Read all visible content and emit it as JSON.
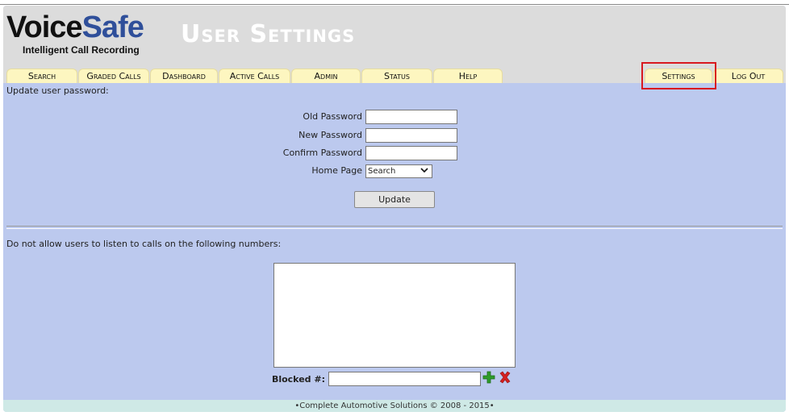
{
  "header": {
    "logo_voice": "Voice",
    "logo_safe": "Safe",
    "logo_subtitle": "Intelligent Call Recording",
    "page_title": "User Settings"
  },
  "nav": {
    "tabs": [
      {
        "label": "Search"
      },
      {
        "label": "Graded Calls"
      },
      {
        "label": "Dashboard"
      },
      {
        "label": "Active Calls"
      },
      {
        "label": "Admin"
      },
      {
        "label": "Status"
      },
      {
        "label": "Help"
      },
      {
        "label": "Settings"
      },
      {
        "label": "Log Out"
      }
    ]
  },
  "password_section": {
    "heading": "Update user password:",
    "old_password_label": "Old Password",
    "old_password_value": "",
    "new_password_label": "New Password",
    "new_password_value": "",
    "confirm_password_label": "Confirm Password",
    "confirm_password_value": "",
    "home_page_label": "Home Page",
    "home_page_selected": "Search",
    "update_button": "Update"
  },
  "blocked_section": {
    "heading": "Do not allow users to listen to calls on the following numbers:",
    "blocked_label": "Blocked #:",
    "blocked_value": ""
  },
  "footer": {
    "text": "•Complete Automotive Solutions © 2008 - 2015•"
  },
  "colors": {
    "content_bg": "#bcc9ee",
    "header_bg": "#dcdcdc",
    "tab_bg": "#fdf6c0",
    "logo_blue": "#2f4f9a",
    "highlight_red": "#d8191f",
    "footer_bg": "#cfe9e6",
    "add_green": "#2e9c2a",
    "remove_red": "#d42020"
  },
  "icons": {
    "add": "plus-icon",
    "remove": "x-icon"
  }
}
